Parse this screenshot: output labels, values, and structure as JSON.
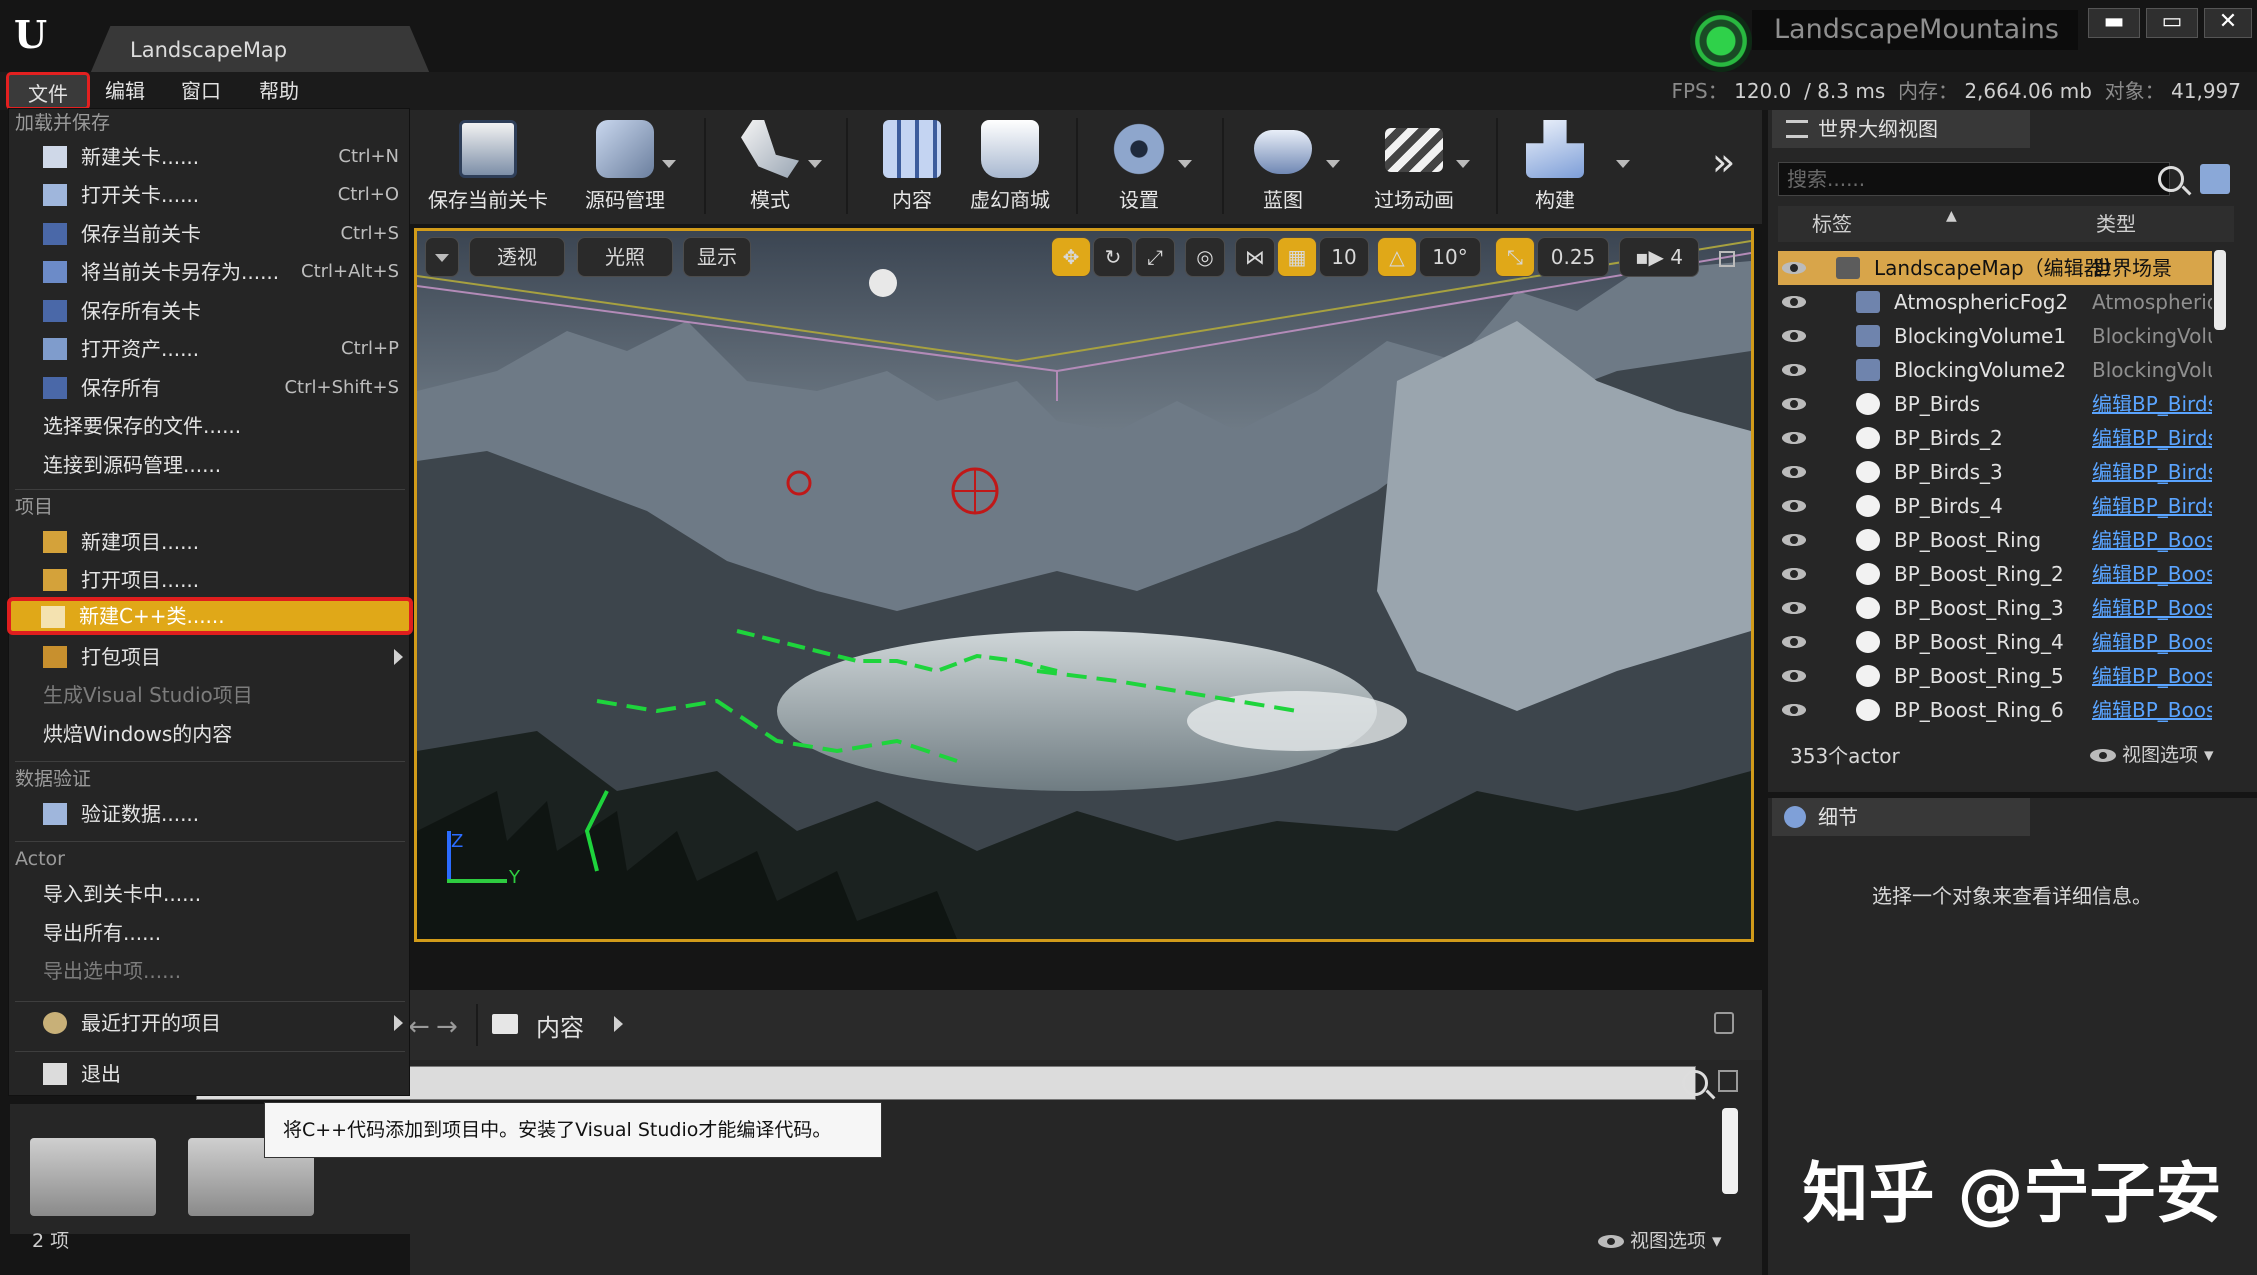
{
  "window": {
    "level_tab": "LandscapeMap",
    "project_name": "LandscapeMountains",
    "min_glyph": "▬",
    "max_glyph": "▭",
    "close_glyph": "✕"
  },
  "menubar": {
    "file": "文件",
    "edit": "编辑",
    "window": "窗口",
    "help": "帮助",
    "fps_label": "FPS：",
    "fps_value": "120.0",
    "frame_ms": "/ 8.3 ms",
    "mem_label": "内存：",
    "mem_value": "2,664.06 mb",
    "obj_label": "对象：",
    "obj_value": "41,997"
  },
  "file_menu": {
    "sec_load_save": "加载并保存",
    "new_level": "新建关卡......",
    "new_level_sc": "Ctrl+N",
    "open_level": "打开关卡......",
    "open_level_sc": "Ctrl+O",
    "save_current": "保存当前关卡",
    "save_current_sc": "Ctrl+S",
    "save_as": "将当前关卡另存为......",
    "save_as_sc": "Ctrl+Alt+S",
    "save_all_levels": "保存所有关卡",
    "open_asset": "打开资产......",
    "open_asset_sc": "Ctrl+P",
    "save_all": "保存所有",
    "save_all_sc": "Ctrl+Shift+S",
    "choose_files": "选择要保存的文件......",
    "connect_scm": "连接到源码管理......",
    "sec_project": "项目",
    "new_project": "新建项目......",
    "open_project": "打开项目......",
    "new_cpp_class": "新建C++类......",
    "package_project": "打包项目",
    "gen_vs": "生成Visual Studio项目",
    "cook_windows": "烘焙Windows的内容",
    "sec_data_validation": "数据验证",
    "validate_data": "验证数据......",
    "sec_actor": "Actor",
    "import_level": "导入到关卡中......",
    "export_all": "导出所有......",
    "export_selected": "导出选中项......",
    "recent_projects": "最近打开的项目",
    "exit": "退出"
  },
  "toolbar": {
    "save_current": "保存当前关卡",
    "source_control": "源码管理",
    "modes": "模式",
    "content": "内容",
    "marketplace": "虚幻商城",
    "settings": "设置",
    "blueprints": "蓝图",
    "cinematics": "过场动画",
    "build": "构建",
    "more": "»"
  },
  "viewport": {
    "perspective": "透视",
    "lit": "光照",
    "show": "显示",
    "grid_snap": "10",
    "rot_snap": "10°",
    "scale_snap": "0.25",
    "cam_speed": "4",
    "axis_y": "Y",
    "axis_z": "Z"
  },
  "outliner": {
    "tab": "世界大纲视图",
    "search_placeholder": "搜索......",
    "col_label": "标签",
    "col_type": "类型",
    "rows": [
      {
        "name": "LandscapeMap（编辑器）",
        "type": "世界场景"
      },
      {
        "name": "AtmosphericFog2",
        "type": "AtmosphericFog"
      },
      {
        "name": "BlockingVolume1",
        "type": "BlockingVolume"
      },
      {
        "name": "BlockingVolume2",
        "type": "BlockingVolume"
      },
      {
        "name": "BP_Birds",
        "type": "编辑BP_Birds"
      },
      {
        "name": "BP_Birds_2",
        "type": "编辑BP_Birds"
      },
      {
        "name": "BP_Birds_3",
        "type": "编辑BP_Birds"
      },
      {
        "name": "BP_Birds_4",
        "type": "编辑BP_Birds"
      },
      {
        "name": "BP_Boost_Ring",
        "type": "编辑BP_Boost_Ring"
      },
      {
        "name": "BP_Boost_Ring_2",
        "type": "编辑BP_Boost_Ring"
      },
      {
        "name": "BP_Boost_Ring_3",
        "type": "编辑BP_Boost_Ring"
      },
      {
        "name": "BP_Boost_Ring_4",
        "type": "编辑BP_Boost_Ring"
      },
      {
        "name": "BP_Boost_Ring_5",
        "type": "编辑BP_Boost_Ring"
      },
      {
        "name": "BP_Boost_Ring_6",
        "type": "编辑BP_Boost_Ring"
      }
    ],
    "actor_count": "353个actor",
    "view_options": "视图选项"
  },
  "details": {
    "tab": "细节",
    "message": "选择一个对象来查看详细信息。"
  },
  "content_browser": {
    "path": "内容",
    "tooltip": "将C++代码添加到项目中。安装了Visual Studio才能编译代码。",
    "item_count": "2 项",
    "view_options": "视图选项"
  },
  "watermark": "知乎 @宁子安",
  "colors": {
    "accent": "#e0a818",
    "highlight_border": "#e01e1e",
    "selection": "#d8a54a",
    "link": "#5aa4ff"
  }
}
